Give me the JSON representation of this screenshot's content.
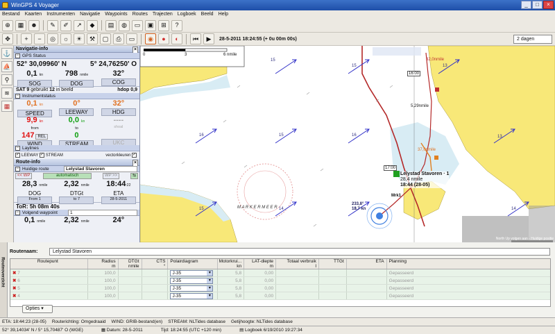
{
  "window": {
    "title": "WinGPS 4 Voyager"
  },
  "menu": [
    "Bestand",
    "Kaarten",
    "Instrumenten",
    "Navigatie",
    "Waypoints",
    "Routes",
    "Trajecten",
    "Logboek",
    "Beeld",
    "Help"
  ],
  "toolbar": {
    "timestamp": "28-5-2011  18:24:55  (+ 0u 00m 00s)",
    "days": "2 dagen"
  },
  "nav_info": {
    "title": "Navigatie-info",
    "gps_label": "GPS Status",
    "lat": "52° 30,09960' N",
    "lon": "5° 24,76250' O",
    "sog": "0,1",
    "sog_unit": "kn",
    "sog_label": "SOG",
    "dog": "798",
    "dog_unit": "nmile",
    "dog_label": "DOG",
    "cog": "32",
    "cog_unit": "°",
    "cog_label": "COG",
    "sat": "SAT 9",
    "sat_used": "gebruikt",
    "sat_count": "12",
    "sat_view": "in beeld",
    "hdop": "hdop 0,9"
  },
  "instr": {
    "title": "Instrumentstatus",
    "speed": "0,1",
    "speed_unit": "kn",
    "speed_label": "SPEED",
    "leeway": "0",
    "leeway_unit": "°",
    "leeway_label": "LEEWAY",
    "hdg": "32",
    "hdg_unit": "°",
    "hdg_label": "HDG",
    "wind_speed": "9,9",
    "wind_unit": "kn",
    "from_label": "from",
    "wind_dir": "147",
    "rel_label": "REL",
    "wind_label": "WIND",
    "stream_speed": "0,0",
    "stream_unit": "kn",
    "to_label": "to",
    "stream_dir": "0",
    "stream_label": "STREAM",
    "ukc_depth": "----",
    "ukc_shoal": "shoal",
    "ukc_label": "UKC"
  },
  "laylines": {
    "title": "Laylines",
    "leeway": "LEEWAY",
    "stream": "STREAM",
    "vector": "vectorkleuren"
  },
  "route_info": {
    "title": "Route-info",
    "current_label": "Huidige route",
    "route_name": "Lelystad  Stavoren",
    "prev_btn": "<< WP",
    "auto_btn": "automatisch",
    "next_btn": "WP >>",
    "dog": "28,3",
    "dog_unit": "nmile",
    "dog_label": "DOG",
    "from_label": "From 1",
    "dtgt": "2,32",
    "dtgt_unit": "nmile",
    "dtgt_label": "DTGt",
    "to_label": "to 7",
    "eta": "18:44",
    "eta_sec": ":22",
    "eta_label": "ETA",
    "eta_date": "28-5-2011",
    "tor": "ToR: 5h 08m 40s",
    "next_label": "Volgend waypoint",
    "next_value": "1",
    "next_dist": "0,1",
    "next_dist_unit": "nmile",
    "next_dtg": "2,32",
    "next_dtg_unit": "nmile",
    "next_angle": "24°"
  },
  "map": {
    "scale": "6 nmile",
    "scale_marks": [
      "0",
      "3"
    ],
    "labels": [
      "15",
      "16",
      "15",
      "15",
      "16",
      "15",
      "14",
      "16",
      "13",
      "13",
      "14"
    ],
    "place": "Lelystad  Stavoren · 1",
    "place_dist": "28,4 nmile",
    "place_eta": "18:44 (28-05)",
    "speed": "233,8°",
    "speed2": "13,7 kn",
    "dist1": "5,29nmile",
    "dist2": "32,0nmile",
    "dist3": "37,0nmile",
    "time1": "16:00",
    "time2": "17:00",
    "status": "North Up volgen aan - Huidige positie",
    "marker": "Mrk1",
    "water": "M A R K E R M E E R"
  },
  "routes": {
    "side_label": "Routeoverzicht",
    "name_label": "Routenaam:",
    "name": "Lelystad  Stavoren",
    "columns": [
      [
        "Routepunt",
        ""
      ],
      [
        "Radius",
        "m"
      ],
      [
        "DTGt",
        "nmile"
      ],
      [
        "CTS",
        "°"
      ],
      [
        "Polairdiagram",
        ""
      ],
      [
        "Motorkrui...",
        "kn"
      ],
      [
        "LAT-diepte",
        "m"
      ],
      [
        "Totaal verbruik",
        "l"
      ],
      [
        "TTGt",
        ""
      ],
      [
        "ETA",
        ""
      ],
      [
        "Planning",
        ""
      ]
    ],
    "rows": [
      {
        "id": "7",
        "radius": "100,0",
        "polar": "J-35",
        "motor": "5,8",
        "lat": "0,00",
        "plan": "Gepasseerd"
      },
      {
        "id": "6",
        "radius": "100,0",
        "polar": "J-35",
        "motor": "5,8",
        "lat": "0,00",
        "plan": "Gepasseerd"
      },
      {
        "id": "5",
        "radius": "100,0",
        "polar": "J-35",
        "motor": "5,8",
        "lat": "0,00",
        "plan": "Gepasseerd"
      },
      {
        "id": "4",
        "radius": "100,0",
        "polar": "J-35",
        "motor": "5,8",
        "lat": "0,00",
        "plan": "Gepasseerd"
      }
    ],
    "options": "Opties"
  },
  "status": {
    "line1": [
      "ETA: 18:44:23 (28-05)",
      "Routerichting: Omgedraaid",
      "WIND: GRIB-bestand(en)",
      "STREAM: NLTides database",
      "Getijhoogte: NLTides database"
    ],
    "pos": "52° 39,14034' N / 5° 15,70487' O (WGE)",
    "datum": "Datum: 28-5-2011",
    "tijd": "Tijd: 18:24:55 (UTC +120 min)",
    "logboek": "Logboek 6/19/2010 19:27:34"
  },
  "colors": {
    "route_line": "#b42828",
    "arrow": "#3030c8",
    "land": "#f8e878",
    "heading": "#e08020"
  }
}
